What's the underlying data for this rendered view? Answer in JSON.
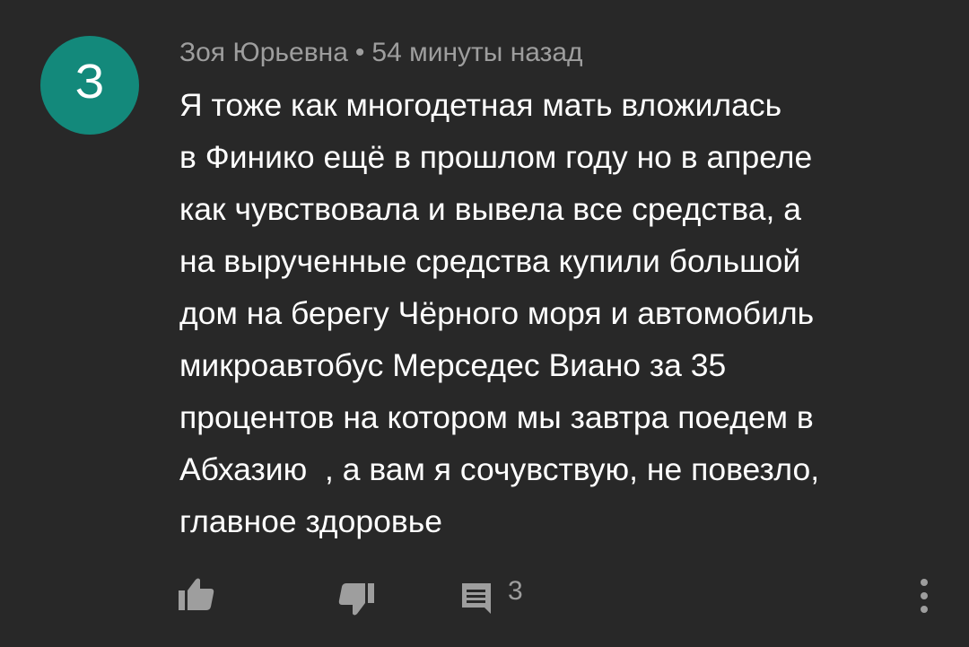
{
  "comment": {
    "avatar_letter": "З",
    "avatar_color": "#13897b",
    "author": "Зоя Юрьевна",
    "separator": "•",
    "time": "54 минуты назад",
    "text": "Я тоже как многодетная мать вложилась\nв Финико ещё в прошлом году но в апреле\nкак чувствовала и вывела все средства, а\nна вырученные средства купили большой\nдом на берегу Чёрного моря и автомобиль\nмикроавтобус Мерседес Виано за 35\nпроцентов на котором мы завтра поедем в\nАбхазию  , а вам я сочувствую, не повезло,\nглавное здоровье"
  },
  "actions": {
    "like_icon": "thumbs-up-icon",
    "dislike_icon": "thumbs-down-icon",
    "reply_icon": "comment-icon",
    "reply_count": "3",
    "more_icon": "more-vertical-icon"
  }
}
